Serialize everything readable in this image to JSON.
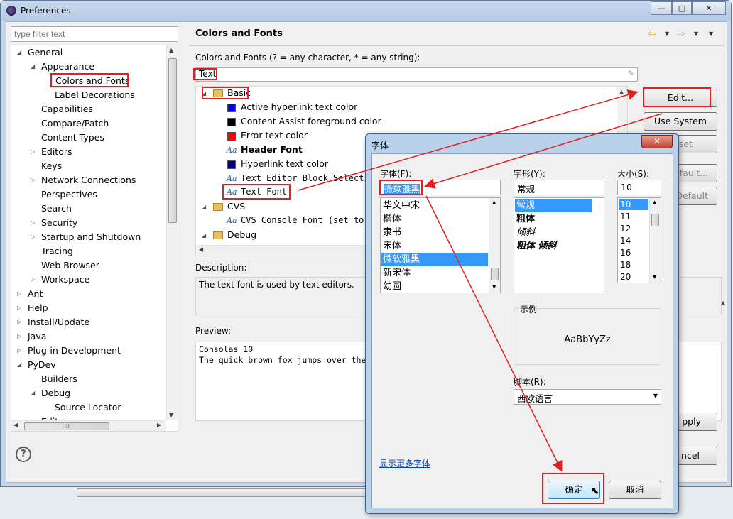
{
  "window": {
    "title": "Preferences",
    "buttons": [
      "—",
      "□",
      "✕"
    ]
  },
  "filter": {
    "placeholder": "type filter text"
  },
  "tree": [
    {
      "label": "General",
      "level": 0,
      "toggle": "open"
    },
    {
      "label": "Appearance",
      "level": 1,
      "toggle": "open"
    },
    {
      "label": "Colors and Fonts",
      "level": 2,
      "toggle": "none",
      "selected": true
    },
    {
      "label": "Label Decorations",
      "level": 2,
      "toggle": "none"
    },
    {
      "label": "Capabilities",
      "level": 1,
      "toggle": "none"
    },
    {
      "label": "Compare/Patch",
      "level": 1,
      "toggle": "none"
    },
    {
      "label": "Content Types",
      "level": 1,
      "toggle": "none"
    },
    {
      "label": "Editors",
      "level": 1,
      "toggle": "closed"
    },
    {
      "label": "Keys",
      "level": 1,
      "toggle": "none"
    },
    {
      "label": "Network Connections",
      "level": 1,
      "toggle": "closed"
    },
    {
      "label": "Perspectives",
      "level": 1,
      "toggle": "none"
    },
    {
      "label": "Search",
      "level": 1,
      "toggle": "none"
    },
    {
      "label": "Security",
      "level": 1,
      "toggle": "closed"
    },
    {
      "label": "Startup and Shutdown",
      "level": 1,
      "toggle": "closed"
    },
    {
      "label": "Tracing",
      "level": 1,
      "toggle": "none"
    },
    {
      "label": "Web Browser",
      "level": 1,
      "toggle": "none"
    },
    {
      "label": "Workspace",
      "level": 1,
      "toggle": "closed"
    },
    {
      "label": "Ant",
      "level": 0,
      "toggle": "closed"
    },
    {
      "label": "Help",
      "level": 0,
      "toggle": "closed"
    },
    {
      "label": "Install/Update",
      "level": 0,
      "toggle": "closed"
    },
    {
      "label": "Java",
      "level": 0,
      "toggle": "closed"
    },
    {
      "label": "Plug-in Development",
      "level": 0,
      "toggle": "closed"
    },
    {
      "label": "PyDev",
      "level": 0,
      "toggle": "open"
    },
    {
      "label": "Builders",
      "level": 1,
      "toggle": "none"
    },
    {
      "label": "Debug",
      "level": 1,
      "toggle": "open"
    },
    {
      "label": "Source Locator",
      "level": 2,
      "toggle": "none"
    },
    {
      "label": "Editor",
      "level": 1,
      "toggle": "open"
    }
  ],
  "tree_hscroll": "III",
  "page": {
    "title": "Colors and Fonts",
    "instructions": "Colors and Fonts (? = any character, * = any string):",
    "search_value": "Text",
    "font_items": {
      "basic": "Basic",
      "active_hyperlink": "Active hyperlink text color",
      "content_assist": "Content Assist foreground color",
      "error_text": "Error text color",
      "header_font": "Header Font",
      "hyperlink_text": "Hyperlink text color",
      "text_editor_block": "Text Editor Block Selecti",
      "text_font": "Text Font",
      "cvs": "CVS",
      "cvs_console": "CVS Console Font (set to",
      "debug": "Debug"
    },
    "swatch_colors": {
      "active_hyperlink": "#0000ff",
      "content_assist": "#000000",
      "error_text": "#ff0000",
      "hyperlink_text": "#000080"
    },
    "buttons": {
      "edit": "Edit...",
      "use_system_font": "Use System Font",
      "reset": "eset",
      "edit_default": "efault...",
      "go_to_default": "Default",
      "apply": "pply",
      "cancel": "ncel"
    },
    "description_label": "Description:",
    "description": "The text font is used by text editors.",
    "preview_label": "Preview:",
    "preview_line1": "Consolas 10",
    "preview_line2": "The quick brown fox jumps over the"
  },
  "font_dialog": {
    "title": "字体",
    "font_label": "字体(F):",
    "font_value": "微软雅黑",
    "fonts": [
      "华文中宋",
      "楷体",
      "隶书",
      "宋体",
      "微软雅黑",
      "新宋体",
      "幼圆"
    ],
    "selected_font": "微软雅黑",
    "style_label": "字形(Y):",
    "style_value": "常规",
    "styles": [
      "常规",
      "粗体",
      "倾斜",
      "粗体 倾斜"
    ],
    "size_label": "大小(S):",
    "size_value": "10",
    "sizes": [
      "10",
      "11",
      "12",
      "14",
      "16",
      "18",
      "20"
    ],
    "sample_label": "示例",
    "sample_text": "AaBbYyZz",
    "script_label": "脚本(R):",
    "script_value": "西欧语言",
    "more_fonts": "显示更多字体",
    "ok": "确定",
    "cancel": "取消"
  },
  "colors": {
    "accent": "#3399ff",
    "annotation": "#e02020",
    "link": "#0645ad"
  }
}
